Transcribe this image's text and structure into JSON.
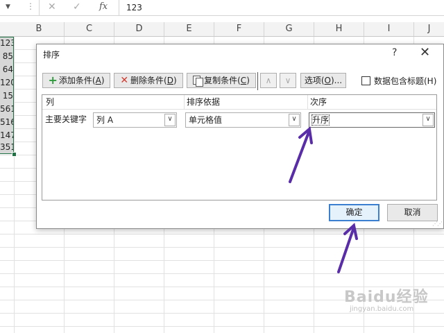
{
  "formula_bar": {
    "cancel_icon": "x-icon",
    "enter_icon": "check-icon",
    "function_label": "fx",
    "value": "123"
  },
  "columns": [
    "B",
    "C",
    "D",
    "E",
    "F",
    "G",
    "H",
    "I",
    "J"
  ],
  "column_a_values": [
    "123",
    "85",
    "64",
    "120",
    "15",
    "561",
    "516",
    "147",
    "351"
  ],
  "dialog": {
    "title": "排序",
    "help": "?",
    "close": "✕",
    "toolbar": {
      "add_label": "添加条件(",
      "add_key": "A",
      "del_label": "删除条件(",
      "del_key": "D",
      "copy_label": "复制条件(",
      "copy_key": "C",
      "up": "∧",
      "down": "∨",
      "options_label": "选项(",
      "options_key": "O",
      "options_suffix": ")...",
      "header_checkbox_label": "数据包含标题(H)",
      "header_checkbox_checked": false
    },
    "table": {
      "headers": [
        "列",
        "排序依据",
        "次序"
      ],
      "row_label": "主要关键字",
      "column_value": "列 A",
      "sort_on_value": "单元格值",
      "order_value": "升序"
    },
    "ok_label": "确定",
    "cancel_label": "取消"
  },
  "annotation": {
    "arrow_color": "#5a2da8"
  },
  "watermark": {
    "main": "Baidu经验",
    "sub": "jingyan.baidu.com"
  }
}
